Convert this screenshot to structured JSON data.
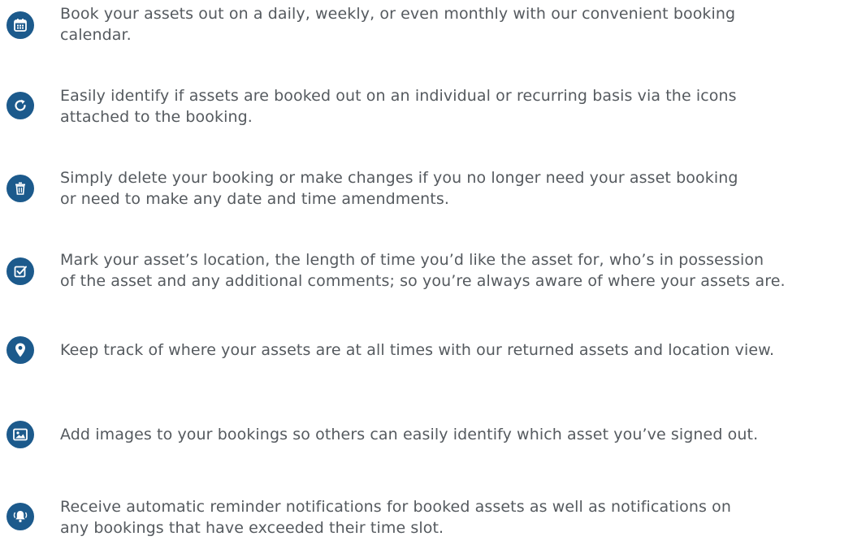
{
  "accent_color": "#1c5a8c",
  "text_color": "#555a5f",
  "features": [
    {
      "icon": "calendar-icon",
      "lines": [
        "Book your assets out on a daily, weekly, or even monthly with our convenient booking",
        "calendar."
      ]
    },
    {
      "icon": "recurring-icon",
      "lines": [
        "Easily identify if assets are booked out on an individual or recurring basis via the icons",
        "attached to the booking."
      ]
    },
    {
      "icon": "trash-icon",
      "lines": [
        "Simply delete your booking or make changes if you no longer need your asset booking",
        "or need to make any date and time amendments."
      ]
    },
    {
      "icon": "checkbox-icon",
      "lines": [
        "Mark your asset’s location, the length of time you’d like the asset for, who’s in possession",
        "of the asset and any additional comments; so you’re always aware of where your assets are."
      ]
    },
    {
      "icon": "location-pin-icon",
      "lines": [
        "Keep track of where your assets are at all times with our returned assets and location view."
      ]
    },
    {
      "icon": "image-icon",
      "lines": [
        "Add images to your bookings so others can easily identify which asset you’ve signed out."
      ]
    },
    {
      "icon": "bell-icon",
      "lines": [
        "Receive automatic reminder notifications for booked assets as well as notifications on",
        "any bookings that have exceeded their time slot."
      ]
    }
  ]
}
